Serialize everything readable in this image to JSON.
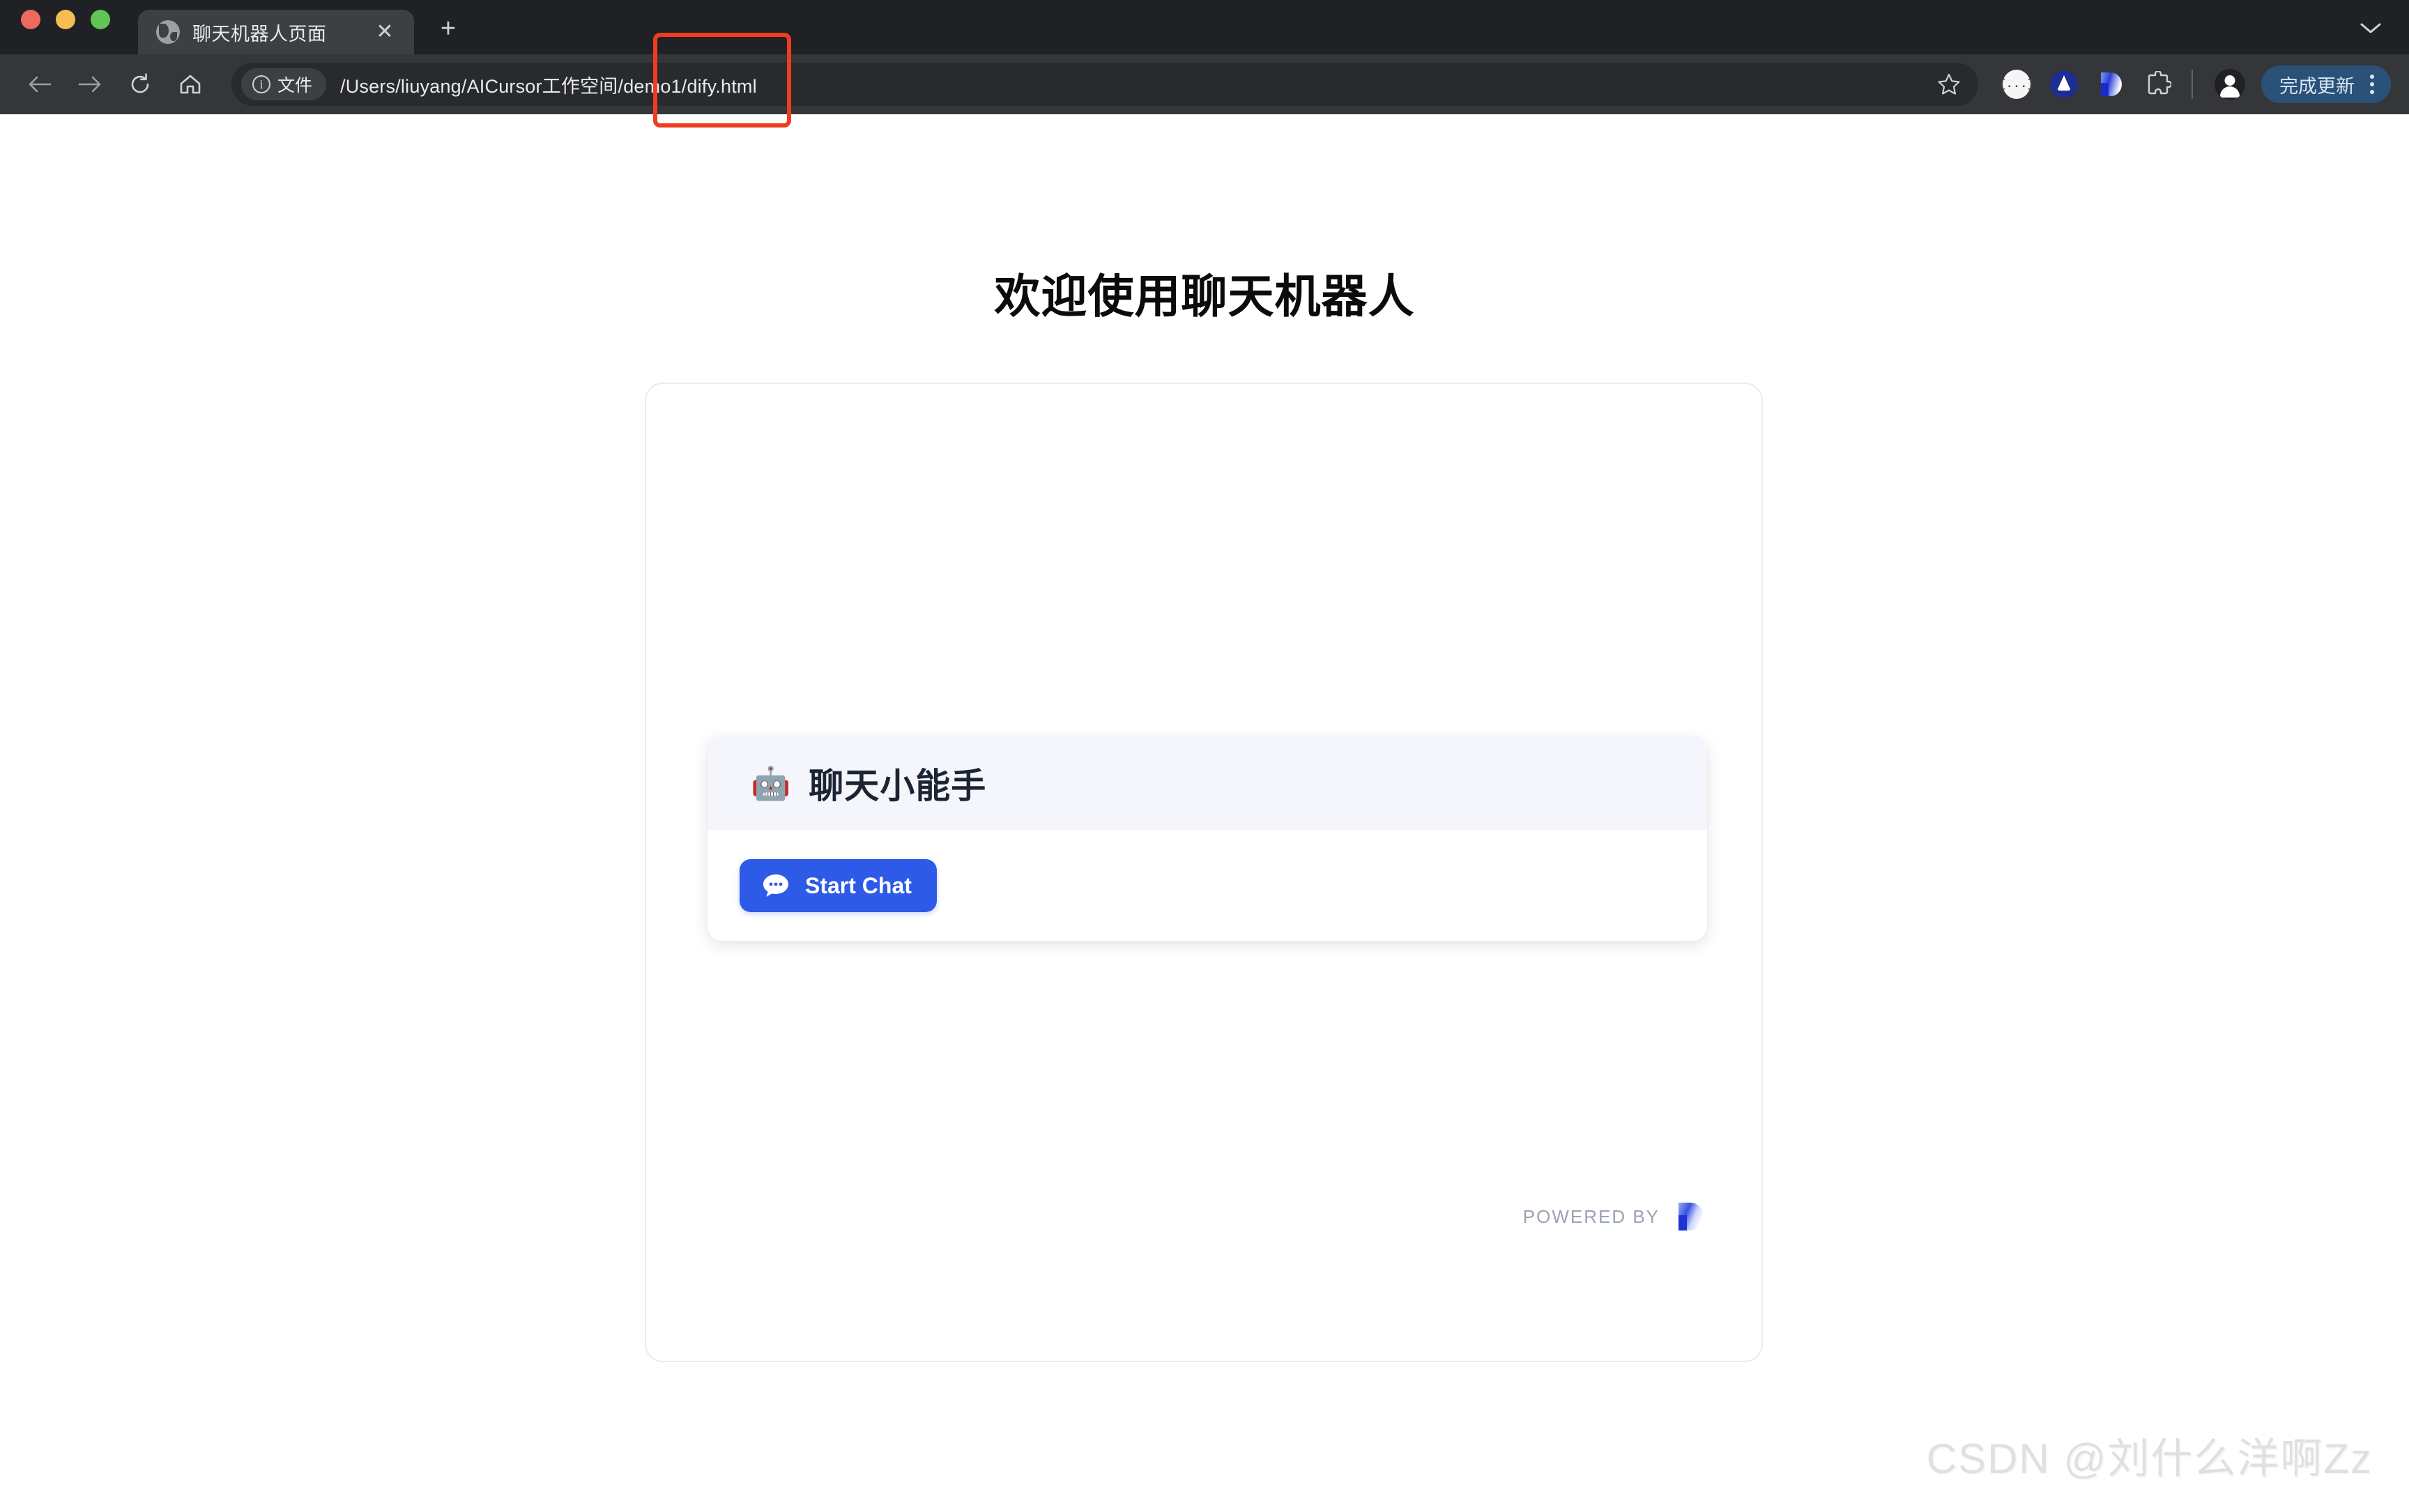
{
  "browser": {
    "window_controls": [
      "close",
      "minimize",
      "maximize"
    ],
    "tab": {
      "title": "聊天机器人页面",
      "favicon": "globe-icon",
      "close_label": "✕"
    },
    "new_tab_label": "+",
    "nav": {
      "back": "back-arrow-icon",
      "forward": "forward-arrow-icon",
      "reload": "reload-icon",
      "home": "home-icon"
    },
    "omnibox": {
      "chip_label": "文件",
      "url": "/Users/liuyang/AICursor工作空间/demo1/dify.html",
      "star": "bookmark-star-icon"
    },
    "extensions": [
      {
        "name": "json-viewer-extension",
        "glyph": "{...}"
      },
      {
        "name": "blue-circle-extension",
        "glyph": ""
      },
      {
        "name": "dify-extension",
        "glyph": "D"
      },
      {
        "name": "extensions-puzzle",
        "glyph": ""
      }
    ],
    "profile": "profile-avatar",
    "update_button": {
      "label": "完成更新",
      "color": "#2a5178"
    },
    "menu": "three-dot-menu"
  },
  "page": {
    "title": "欢迎使用聊天机器人",
    "chat_card": {
      "bot_emoji": "🤖",
      "bot_name": "聊天小能手",
      "start_button_label": "Start Chat",
      "start_button_color": "#2e5ae8",
      "header_bg": "#f4f6fb"
    },
    "powered_by": {
      "label": "POWERED BY",
      "brand": "Dify"
    },
    "watermark": "CSDN @刘什么洋啊Zz"
  }
}
